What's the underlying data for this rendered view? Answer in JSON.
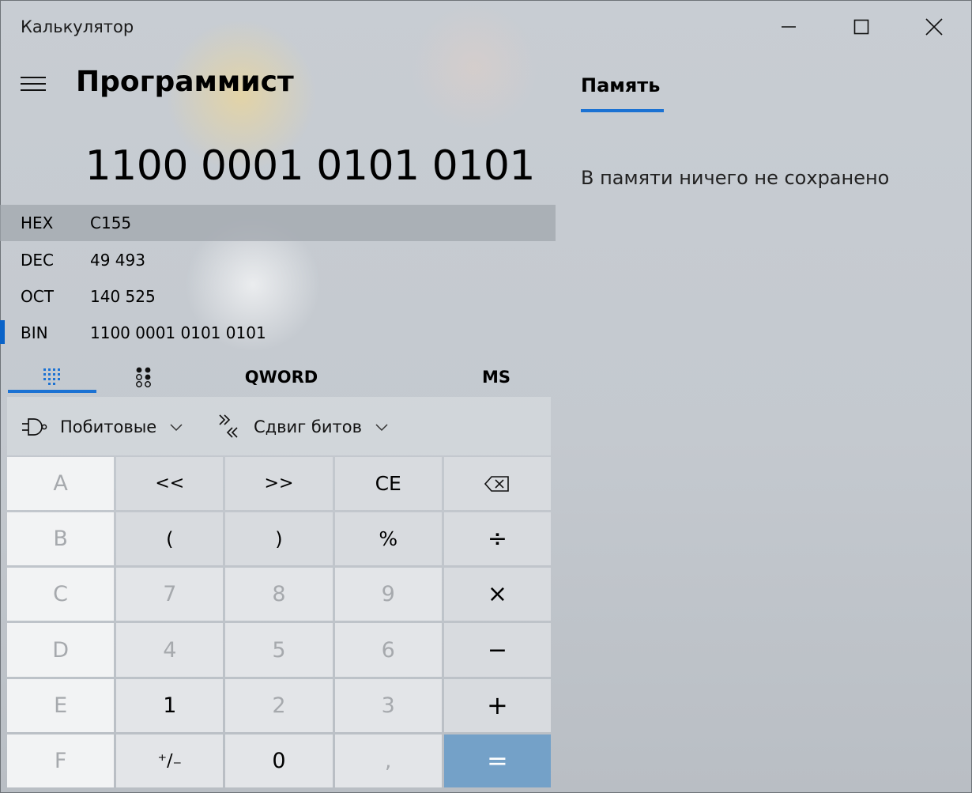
{
  "window": {
    "title": "Калькулятор"
  },
  "header": {
    "mode_title": "Программист"
  },
  "display": {
    "value": "1100 0001 0101 0101"
  },
  "radix": [
    {
      "label": "HEX",
      "value": "C155",
      "active": true
    },
    {
      "label": "DEC",
      "value": "49 493",
      "active": false
    },
    {
      "label": "OCT",
      "value": "140 525",
      "active": false
    },
    {
      "label": "BIN",
      "value": "1100 0001 0101 0101",
      "active": false,
      "selected": true
    }
  ],
  "tabs": {
    "full_keypad_icon": "keypad-grid-icon",
    "bit_toggle_icon": "bit-toggle-icon",
    "word_size": "QWORD",
    "memory_store": "MS"
  },
  "operators": {
    "bitwise_label": "Побитовые",
    "bitshift_label": "Сдвиг битов"
  },
  "keypad": [
    {
      "label": "A",
      "style": "white",
      "state": "disabled"
    },
    {
      "label": "<<",
      "style": "gray"
    },
    {
      "label": ">>",
      "style": "gray"
    },
    {
      "label": "CE",
      "style": "gray"
    },
    {
      "label": "⌫",
      "style": "gray",
      "icon": "backspace-icon"
    },
    {
      "label": "B",
      "style": "white",
      "state": "disabled"
    },
    {
      "label": "(",
      "style": "gray"
    },
    {
      "label": ")",
      "style": "gray"
    },
    {
      "label": "%",
      "style": "gray"
    },
    {
      "label": "÷",
      "style": "gray"
    },
    {
      "label": "C",
      "style": "white",
      "state": "disabled"
    },
    {
      "label": "7",
      "style": "num",
      "state": "disabled"
    },
    {
      "label": "8",
      "style": "num",
      "state": "disabled"
    },
    {
      "label": "9",
      "style": "num",
      "state": "disabled"
    },
    {
      "label": "×",
      "style": "gray"
    },
    {
      "label": "D",
      "style": "white",
      "state": "disabled"
    },
    {
      "label": "4",
      "style": "num",
      "state": "disabled"
    },
    {
      "label": "5",
      "style": "num",
      "state": "disabled"
    },
    {
      "label": "6",
      "style": "num",
      "state": "disabled"
    },
    {
      "label": "−",
      "style": "gray"
    },
    {
      "label": "E",
      "style": "white",
      "state": "disabled"
    },
    {
      "label": "1",
      "style": "num"
    },
    {
      "label": "2",
      "style": "num",
      "state": "disabled"
    },
    {
      "label": "3",
      "style": "num",
      "state": "disabled"
    },
    {
      "label": "+",
      "style": "gray"
    },
    {
      "label": "F",
      "style": "white",
      "state": "disabled"
    },
    {
      "label": "⁺∕₋",
      "style": "num"
    },
    {
      "label": "0",
      "style": "num"
    },
    {
      "label": ",",
      "style": "num",
      "state": "disabled"
    },
    {
      "label": "=",
      "style": "equals"
    }
  ],
  "memory": {
    "tab_label": "Память",
    "empty_text": "В памяти ничего не сохранено"
  },
  "colors": {
    "accent": "#1b72d3",
    "equals_key": "#74a1c8",
    "active_radix_row": "#a0a5ac"
  }
}
